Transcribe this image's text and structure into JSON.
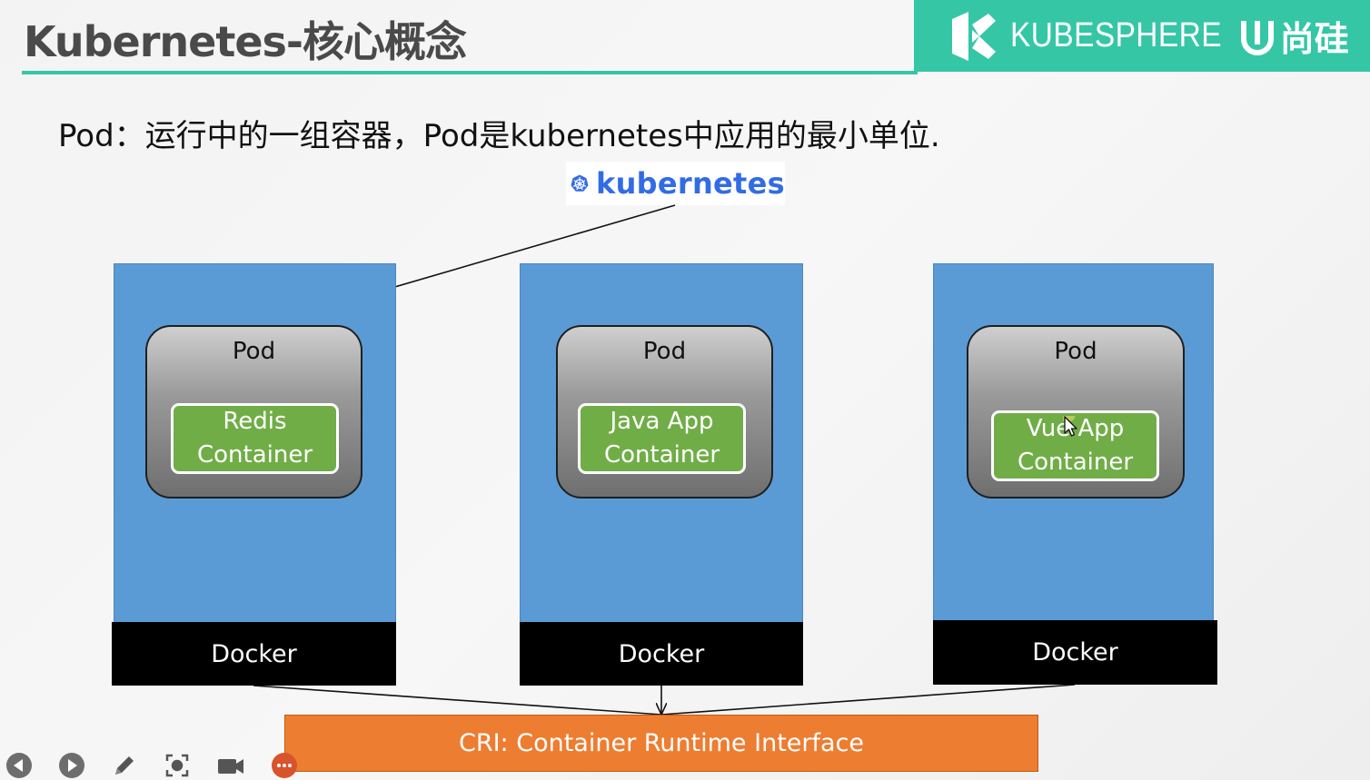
{
  "header": {
    "title": "Kubernetes-核心概念",
    "brand_name": "KUBESPHERE",
    "partner_name": "尚硅",
    "accent_color": "#35c6a6"
  },
  "subtitle": "Pod：运行中的一组容器，Pod是kubernetes中应用的最小单位.",
  "k8s_logo_text": "kubernetes",
  "nodes": [
    {
      "pod_label": "Pod",
      "container_label": "Redis\nContainer",
      "runtime_label": "Docker"
    },
    {
      "pod_label": "Pod",
      "container_label": "Java App\nContainer",
      "runtime_label": "Docker"
    },
    {
      "pod_label": "Pod",
      "container_label": "Vue App\nContainer",
      "runtime_label": "Docker"
    }
  ],
  "cri_label": "CRI: Container Runtime Interface",
  "colors": {
    "node": "#5b9bd5",
    "container": "#70ad47",
    "cri": "#ed7d31",
    "runtime": "#000000"
  },
  "toolbar": {
    "icons": [
      "previous-icon",
      "next-icon",
      "pen-icon",
      "screenshot-icon",
      "camera-icon",
      "more-icon"
    ]
  }
}
